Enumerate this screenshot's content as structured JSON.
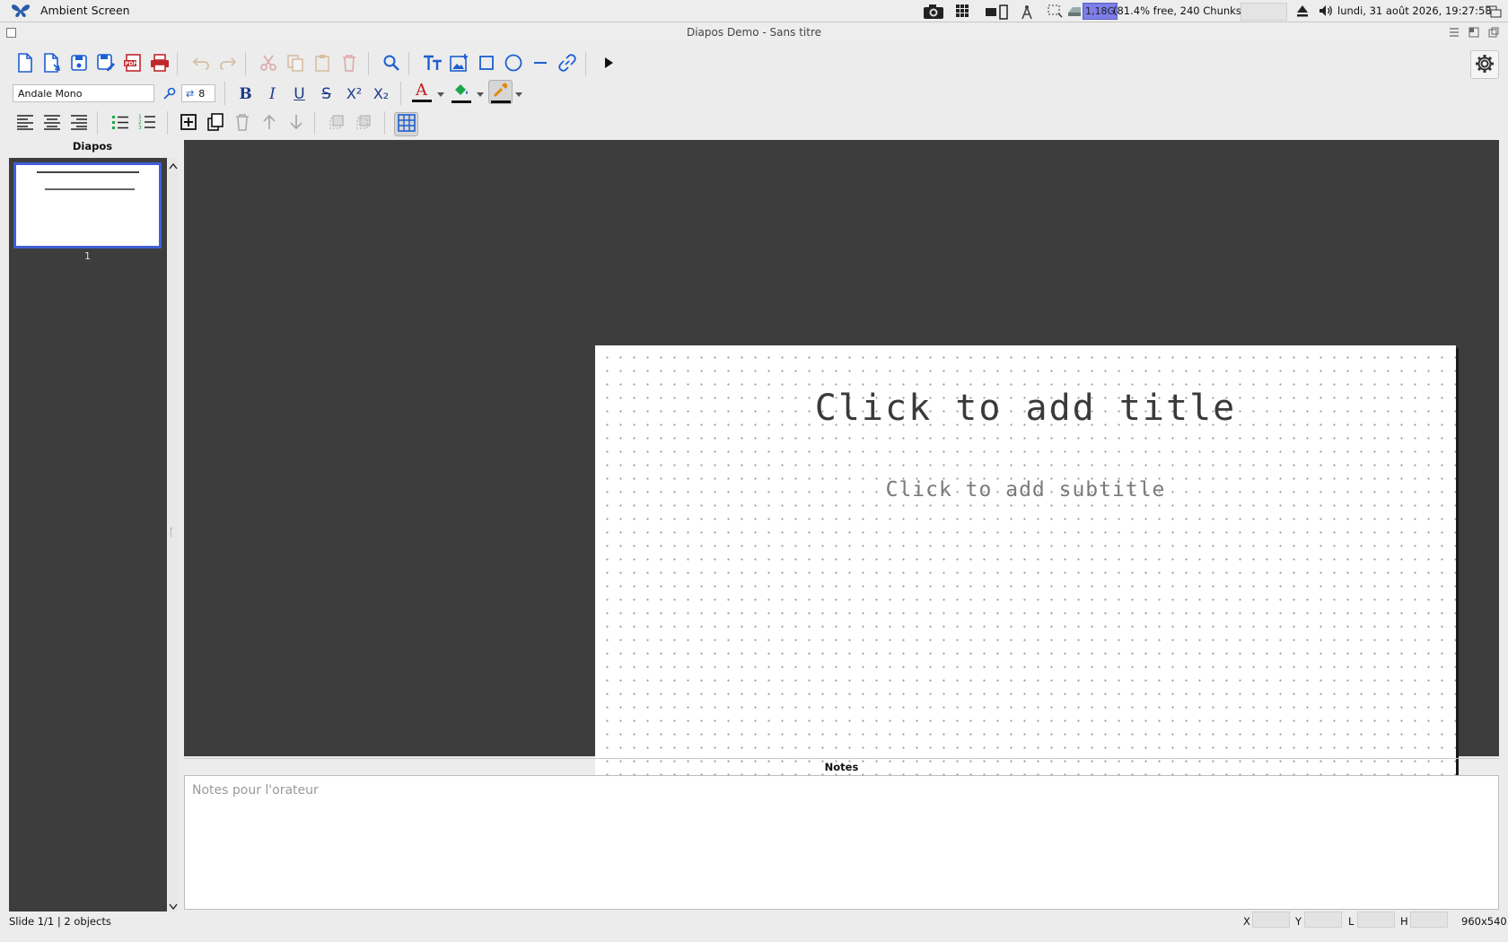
{
  "system": {
    "app_name": "Ambient Screen",
    "memory_value": "1,18G",
    "memory_detail": "(81.4% free, 240 Chunks)",
    "datetime": "lundi, 31 août 2026, 19:27:58"
  },
  "window": {
    "title": "Diapos Demo - Sans titre"
  },
  "toolbar": {
    "font_name": "Andale Mono",
    "font_size": "8",
    "bold": "B",
    "italic": "I",
    "underline": "U",
    "strike": "S",
    "superscript": "X²",
    "subscript": "X₂",
    "text_color": "A"
  },
  "slides_panel": {
    "title": "Diapos",
    "slides": [
      {
        "number": "1"
      }
    ]
  },
  "slide": {
    "title_placeholder": "Click to add title",
    "subtitle_placeholder": "Click to add subtitle"
  },
  "notes": {
    "title": "Notes",
    "placeholder": "Notes pour l'orateur"
  },
  "status": {
    "left": "Slide 1/1 | 2 objects",
    "x_label": "X",
    "y_label": "Y",
    "l_label": "L",
    "h_label": "H",
    "resolution": "960x540"
  },
  "colors": {
    "accent_blue": "#1e5fcf",
    "slide_bg": "#ffffff",
    "canvas_bg": "#3d3d3d",
    "selection": "#3f5fd8"
  }
}
